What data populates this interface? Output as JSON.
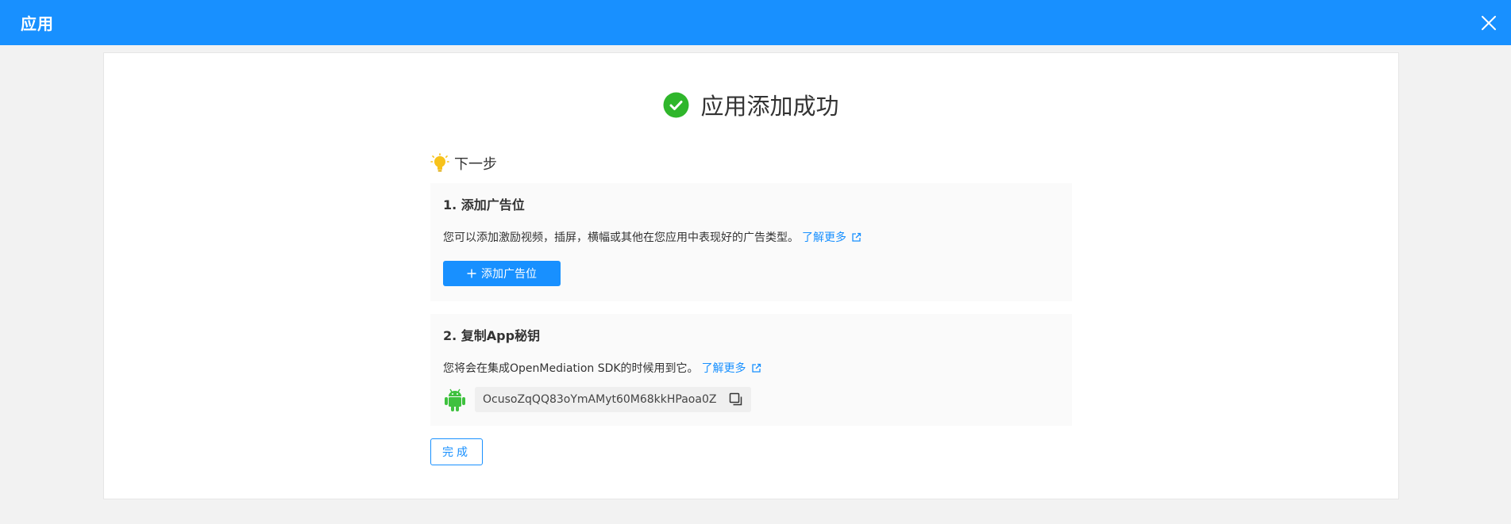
{
  "header": {
    "title": "应用",
    "close_icon": "close-icon"
  },
  "success": {
    "title": "应用添加成功",
    "icon": "check-circle-icon",
    "color": "#2fb62b"
  },
  "next_step": {
    "label": "下一步",
    "icon": "lightbulb-icon"
  },
  "steps": [
    {
      "title": "1. 添加广告位",
      "description": "您可以添加激励视频，插屏，横幅或其他在您应用中表现好的广告类型。",
      "learn_more": "了解更多",
      "button_label": "添加广告位"
    },
    {
      "title": "2. 复制App秘钥",
      "description": "您将会在集成OpenMediation SDK的时候用到它。",
      "learn_more": "了解更多",
      "platform_icon": "android-icon",
      "app_key": "OcusoZqQQ83oYmAMyt60M68kkHPaoa0Z",
      "copy_icon": "copy-icon"
    }
  ],
  "done_button": "完成",
  "colors": {
    "primary": "#1890ff",
    "success": "#2fb62b",
    "android": "#3ec13e"
  }
}
